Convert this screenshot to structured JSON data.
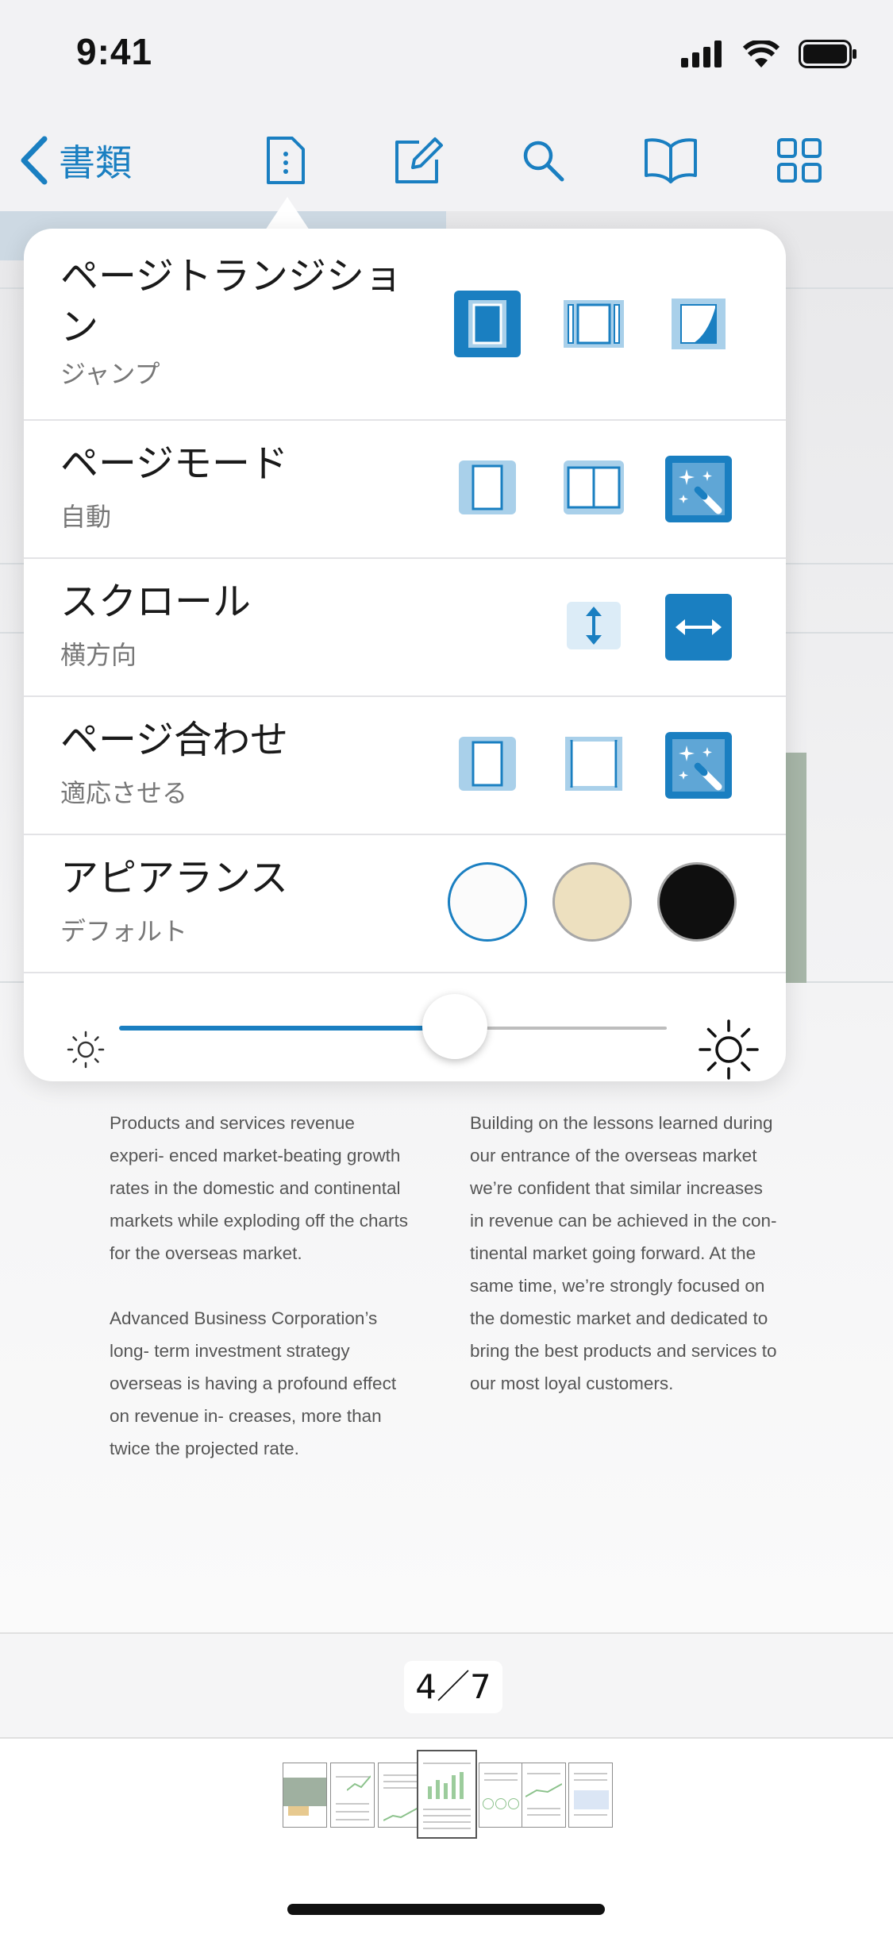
{
  "status": {
    "time": "9:41"
  },
  "toolbar": {
    "back_label": "書類"
  },
  "settings": {
    "rows": [
      {
        "title": "ページトランジション",
        "value": "ジャンプ"
      },
      {
        "title": "ページモード",
        "value": "自動"
      },
      {
        "title": "スクロール",
        "value": "横方向"
      },
      {
        "title": "ページ合わせ",
        "value": "適応させる"
      },
      {
        "title": "アピアランス",
        "value": "デフォルト"
      }
    ],
    "brightness_percent": 53
  },
  "document": {
    "col1": [
      "Products and services revenue experi- enced market-beating growth rates in the domestic and continental markets while exploding off the charts for the overseas market.",
      "Advanced Business Corporation’s long- term investment strategy overseas is having a profound effect on revenue in- creases, more than twice the projected rate."
    ],
    "col2": [
      "Building on the lessons learned during our entrance of the overseas market we’re confident that similar increases in revenue can be achieved in the con- tinental market going forward. At the same time, we’re strongly focused on the domestic market and dedicated to bring the best products and services to our most loyal customers."
    ]
  },
  "pager": {
    "label": "4／7"
  },
  "colors": {
    "accent": "#1a7fc1",
    "light_accent": "#a9d0ea",
    "sepia": "#ede0bf",
    "dark": "#0f0f0f"
  }
}
